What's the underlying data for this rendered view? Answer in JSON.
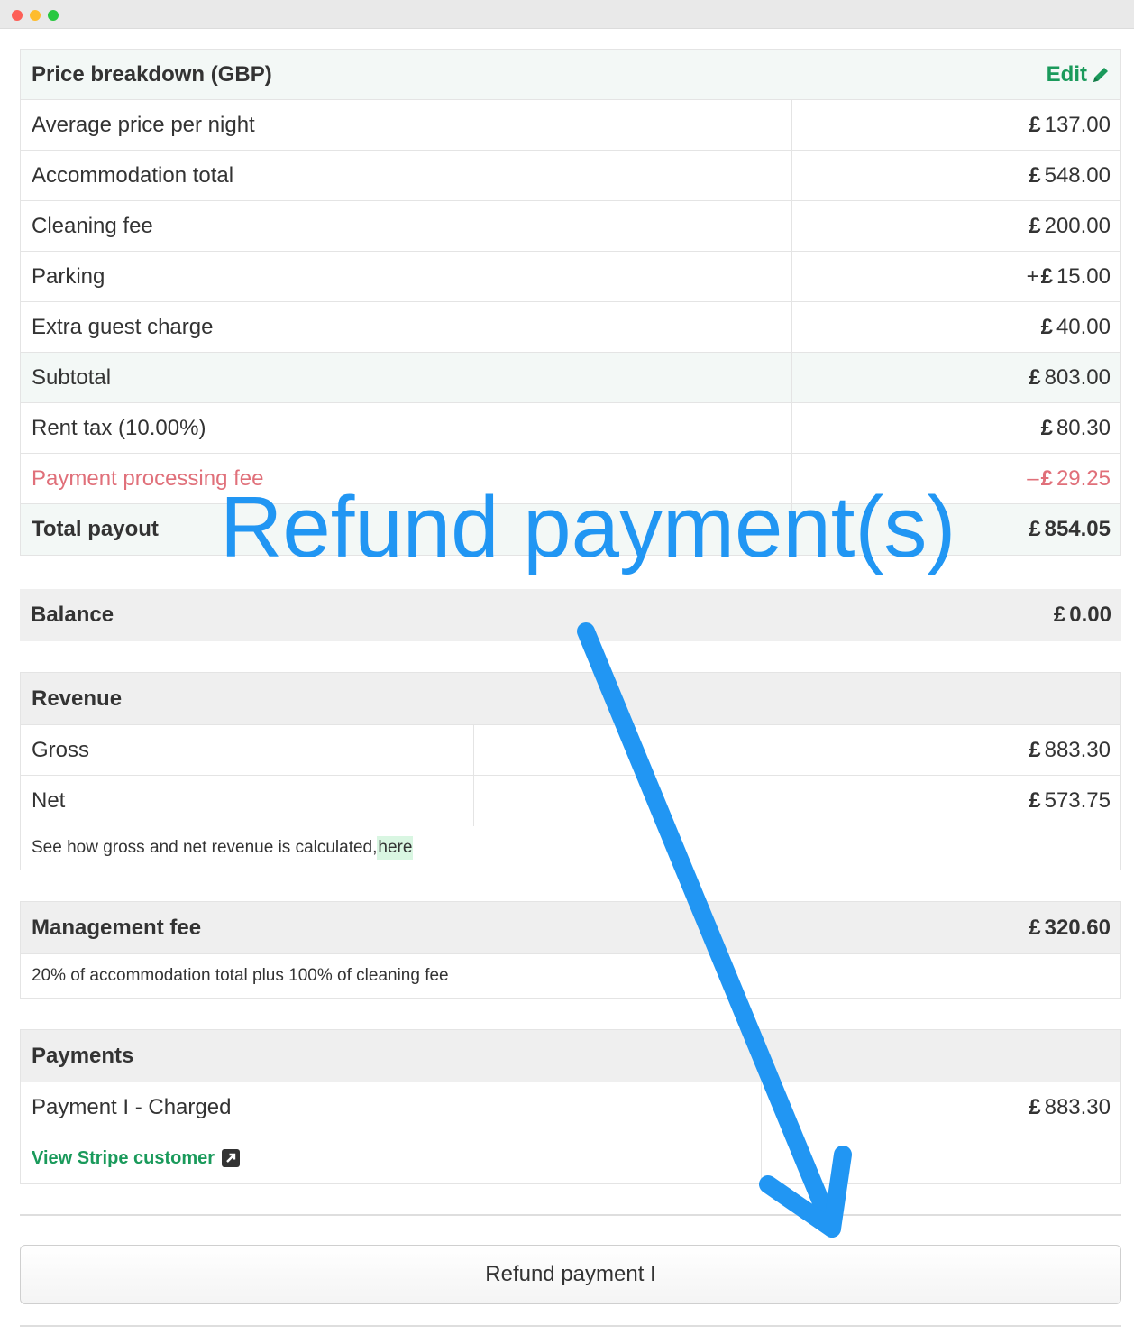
{
  "colors": {
    "accent_green": "#1a9a5b",
    "negative_red": "#e0707a",
    "annotation_blue": "#2196f3"
  },
  "price_breakdown": {
    "title": "Price breakdown (GBP)",
    "edit_label": "Edit",
    "edit_icon": "pencil-icon",
    "rows": [
      {
        "label": "Average price per night",
        "prefix": "",
        "currency": "£",
        "amount": "137.00"
      },
      {
        "label": "Accommodation total",
        "prefix": "",
        "currency": "£",
        "amount": "548.00"
      },
      {
        "label": "Cleaning fee",
        "prefix": "",
        "currency": "£",
        "amount": "200.00"
      },
      {
        "label": "Parking",
        "prefix": "+ ",
        "currency": "£",
        "amount": "15.00"
      },
      {
        "label": "Extra guest charge",
        "prefix": "",
        "currency": "£",
        "amount": "40.00"
      },
      {
        "label": "Subtotal",
        "prefix": "",
        "currency": "£",
        "amount": "803.00"
      },
      {
        "label": "Rent tax (10.00%)",
        "prefix": "",
        "currency": "£",
        "amount": "80.30"
      },
      {
        "label": "Payment processing fee",
        "prefix": "– ",
        "currency": "£",
        "amount": "29.25"
      },
      {
        "label": "Total payout",
        "prefix": "",
        "currency": "£",
        "amount": "854.05"
      }
    ]
  },
  "balance": {
    "label": "Balance",
    "currency": "£",
    "amount": "0.00"
  },
  "revenue": {
    "title": "Revenue",
    "rows": [
      {
        "label": "Gross",
        "currency": "£",
        "amount": "883.30"
      },
      {
        "label": "Net",
        "currency": "£",
        "amount": "573.75"
      }
    ],
    "note_text": "See how gross and net revenue is calculated,",
    "note_link": "here"
  },
  "management_fee": {
    "label": "Management fee",
    "currency": "£",
    "amount": "320.60",
    "description": "20% of accommodation total plus 100% of cleaning fee"
  },
  "payments": {
    "title": "Payments",
    "rows": [
      {
        "label": "Payment I - Charged",
        "currency": "£",
        "amount": "883.30"
      }
    ],
    "stripe_link": "View Stripe customer",
    "stripe_icon": "external-link-icon"
  },
  "refund_button_label": "Refund payment I",
  "annotation": {
    "text": "Refund payment(s)",
    "arrow_icon": "arrow-down-right-icon"
  }
}
